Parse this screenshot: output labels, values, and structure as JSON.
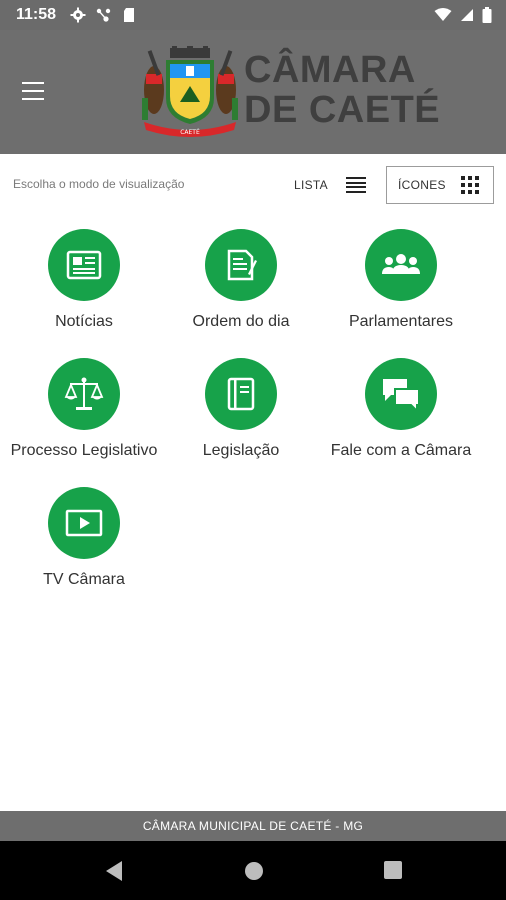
{
  "status_bar": {
    "time": "11:58",
    "icons_left": [
      "gear-icon",
      "network-icon",
      "sd-card-icon"
    ],
    "icons_right": [
      "wifi-icon",
      "signal-icon",
      "battery-icon"
    ]
  },
  "header": {
    "title_line1": "CÂMARA",
    "title_line2": "DE CAETÉ",
    "emblem_text": "CAETÉ",
    "menu_icon": "hamburger-icon"
  },
  "toolbar": {
    "view_mode_label": "Escolha o modo de visualização",
    "list_label": "LISTA",
    "icons_label": "ÍCONES",
    "selected_mode": "ÍCONES"
  },
  "menu": {
    "items": [
      {
        "label": "Notícias",
        "icon": "newspaper-icon"
      },
      {
        "label": "Ordem do dia",
        "icon": "document-edit-icon"
      },
      {
        "label": "Parlamentares",
        "icon": "people-group-icon"
      },
      {
        "label": "Processo Legislativo",
        "icon": "scales-icon"
      },
      {
        "label": "Legislação",
        "icon": "book-icon"
      },
      {
        "label": "Fale com a Câmara",
        "icon": "chat-bubbles-icon"
      },
      {
        "label": "TV Câmara",
        "icon": "video-play-icon"
      }
    ]
  },
  "footer": {
    "text": "CÂMARA MUNICIPAL DE CAETÉ - MG"
  },
  "colors": {
    "accent_green": "#17a24a",
    "header_gray": "#6e6e6e",
    "status_gray": "#6b6b6b"
  }
}
